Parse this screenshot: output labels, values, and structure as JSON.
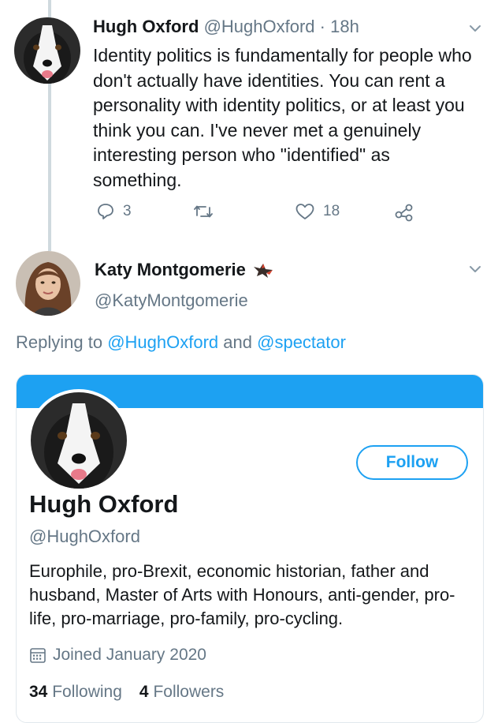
{
  "tweet": {
    "author_name": "Hugh Oxford",
    "handle": "@HughOxford",
    "separator": "·",
    "time": "18h",
    "text": "Identity politics is fundamentally for people who don't actually have identities. You can rent a personality with identity politics, or at least you think you can. I've never met a genuinely interesting person who \"identified\" as something.",
    "reply_count": "3",
    "retweet_count": "",
    "like_count": "18",
    "icons": [
      "reply-icon",
      "retweet-icon",
      "like-icon",
      "share-icon",
      "chevron-down-icon"
    ]
  },
  "reply": {
    "author_name": "Katy Montgomerie",
    "handle": "@KatyMontgomerie",
    "replying_prefix": "Replying to",
    "mention_1": "@HughOxford",
    "and_word": "and",
    "mention_2": "@spectator"
  },
  "profile_card": {
    "name": "Hugh Oxford",
    "handle": "@HughOxford",
    "follow_label": "Follow",
    "bio": "Europhile, pro-Brexit, economic historian, father and husband, Master of Arts with Honours, anti-gender, pro-life, pro-marriage, pro-family, pro-cycling.",
    "joined": "Joined January 2020",
    "following_count": "34",
    "following_label": "Following",
    "followers_count": "4",
    "followers_label": "Followers"
  },
  "colors": {
    "accent": "#1da1f2",
    "muted": "#657786",
    "text": "#14171a",
    "thread_line": "#cfd9de"
  }
}
